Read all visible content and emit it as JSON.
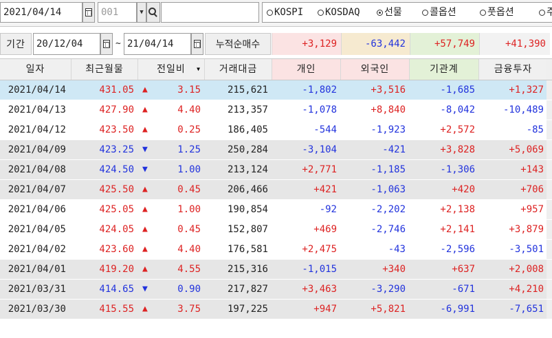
{
  "toolbar": {
    "date": "2021/04/14",
    "code_value": "001",
    "name_value": "",
    "radios": [
      {
        "label": "KOSPI",
        "selected": false
      },
      {
        "label": "KOSDAQ",
        "selected": false
      },
      {
        "label": "선물",
        "selected": true
      },
      {
        "label": "콜옵션",
        "selected": false
      },
      {
        "label": "풋옵션",
        "selected": false
      },
      {
        "label": "주",
        "selected": false
      }
    ]
  },
  "filter": {
    "period_label": "기간",
    "from_date": "20/12/04",
    "tilde": "~",
    "to_date": "21/04/14",
    "cum_label": "누적순매수",
    "net": [
      {
        "value": "+3,129",
        "color": "#dd2222",
        "bg": "#fbe3e3"
      },
      {
        "value": "-63,442",
        "color": "#2233dd",
        "bg": "#f6ead0"
      },
      {
        "value": "+57,749",
        "color": "#dd2222",
        "bg": "#e3f1d7"
      },
      {
        "value": "+41,390",
        "color": "#dd2222",
        "bg": "#f2f2f2"
      }
    ]
  },
  "columns": [
    {
      "label": "일자",
      "bg": "#f0f0f0"
    },
    {
      "label": "최근월물",
      "bg": "#f0f0f0"
    },
    {
      "label": "전일비",
      "bg": "#f0f0f0"
    },
    {
      "label": "거래대금",
      "bg": "#f0f0f0"
    },
    {
      "label": "개인",
      "bg": "#fbe3e3"
    },
    {
      "label": "외국인",
      "bg": "#fbe3e3"
    },
    {
      "label": "기관계",
      "bg": "#e3f1d7"
    },
    {
      "label": "금융투자",
      "bg": "#f0f0f0"
    }
  ],
  "rows": [
    {
      "date": "2021/04/14",
      "price": "431.05",
      "dir": "up",
      "change": "3.15",
      "volume": "215,621",
      "individual": "-1,802",
      "foreign": "+3,516",
      "institution": "-1,685",
      "finance": "+1,327",
      "selected": true,
      "shade": false
    },
    {
      "date": "2021/04/13",
      "price": "427.90",
      "dir": "up",
      "change": "4.40",
      "volume": "213,357",
      "individual": "-1,078",
      "foreign": "+8,840",
      "institution": "-8,042",
      "finance": "-10,489",
      "selected": false,
      "shade": false
    },
    {
      "date": "2021/04/12",
      "price": "423.50",
      "dir": "up",
      "change": "0.25",
      "volume": "186,405",
      "individual": "-544",
      "foreign": "-1,923",
      "institution": "+2,572",
      "finance": "-85",
      "selected": false,
      "shade": false
    },
    {
      "date": "2021/04/09",
      "price": "423.25",
      "dir": "down",
      "change": "1.25",
      "volume": "250,284",
      "individual": "-3,104",
      "foreign": "-421",
      "institution": "+3,828",
      "finance": "+5,069",
      "selected": false,
      "shade": true
    },
    {
      "date": "2021/04/08",
      "price": "424.50",
      "dir": "down",
      "change": "1.00",
      "volume": "213,124",
      "individual": "+2,771",
      "foreign": "-1,185",
      "institution": "-1,306",
      "finance": "+143",
      "selected": false,
      "shade": true
    },
    {
      "date": "2021/04/07",
      "price": "425.50",
      "dir": "up",
      "change": "0.45",
      "volume": "206,466",
      "individual": "+421",
      "foreign": "-1,063",
      "institution": "+420",
      "finance": "+706",
      "selected": false,
      "shade": true
    },
    {
      "date": "2021/04/06",
      "price": "425.05",
      "dir": "up",
      "change": "1.00",
      "volume": "190,854",
      "individual": "-92",
      "foreign": "-2,202",
      "institution": "+2,138",
      "finance": "+957",
      "selected": false,
      "shade": false
    },
    {
      "date": "2021/04/05",
      "price": "424.05",
      "dir": "up",
      "change": "0.45",
      "volume": "152,807",
      "individual": "+469",
      "foreign": "-2,746",
      "institution": "+2,141",
      "finance": "+3,879",
      "selected": false,
      "shade": false
    },
    {
      "date": "2021/04/02",
      "price": "423.60",
      "dir": "up",
      "change": "4.40",
      "volume": "176,581",
      "individual": "+2,475",
      "foreign": "-43",
      "institution": "-2,596",
      "finance": "-3,501",
      "selected": false,
      "shade": false
    },
    {
      "date": "2021/04/01",
      "price": "419.20",
      "dir": "up",
      "change": "4.55",
      "volume": "215,316",
      "individual": "-1,015",
      "foreign": "+340",
      "institution": "+637",
      "finance": "+2,008",
      "selected": false,
      "shade": true
    },
    {
      "date": "2021/03/31",
      "price": "414.65",
      "dir": "down",
      "change": "0.90",
      "volume": "217,827",
      "individual": "+3,463",
      "foreign": "-3,290",
      "institution": "-671",
      "finance": "+4,210",
      "selected": false,
      "shade": true
    },
    {
      "date": "2021/03/30",
      "price": "415.55",
      "dir": "up",
      "change": "3.75",
      "volume": "197,225",
      "individual": "+947",
      "foreign": "+5,821",
      "institution": "-6,991",
      "finance": "-7,651",
      "selected": false,
      "shade": true
    }
  ],
  "colors": {
    "up": "#dd2222",
    "down": "#2233dd",
    "selected": "#cfe8f5",
    "shade": "#e6e6e6"
  },
  "icons": {
    "up": "▲",
    "down": "▼",
    "calendar": "calendar-icon",
    "search": "search-icon",
    "dropdown": "▼"
  }
}
